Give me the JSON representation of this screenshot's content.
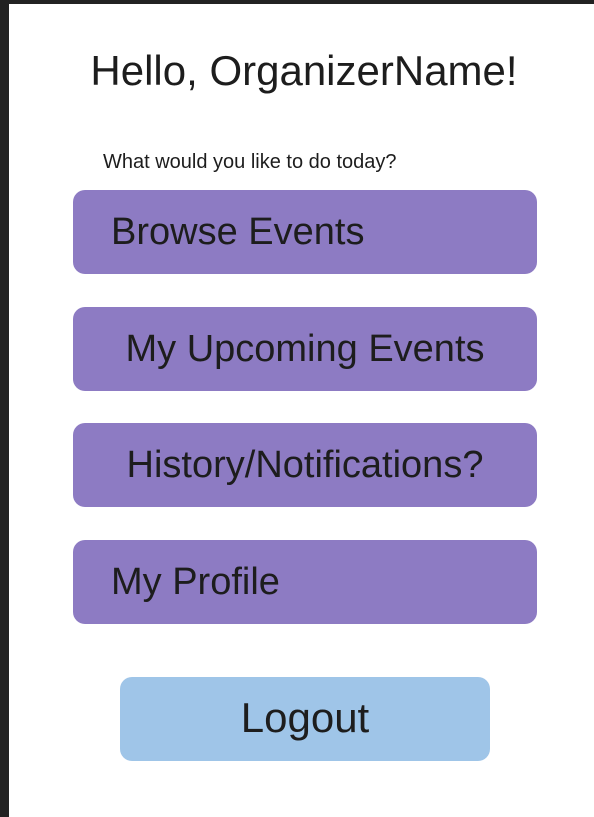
{
  "header": {
    "greeting": "Hello, OrganizerName!",
    "prompt": "What would you like to do today?"
  },
  "menu": {
    "browse_events": "Browse Events",
    "upcoming_events": "My Upcoming Events",
    "history": "History/Notifications?",
    "profile": "My Profile"
  },
  "logout_label": "Logout",
  "colors": {
    "menu_button": "#8d7bc3",
    "logout_button": "#9fc5e8",
    "background": "#ffffff",
    "frame": "#222222"
  }
}
